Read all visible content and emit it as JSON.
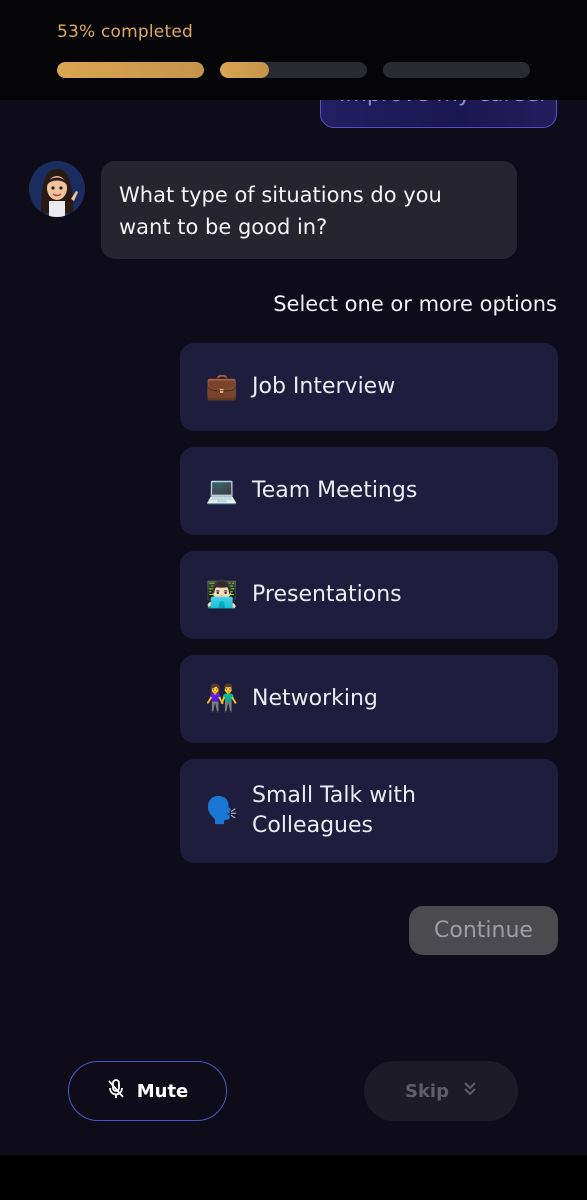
{
  "header": {
    "progress_text": "53% completed",
    "progress_percent": 53,
    "segments": [
      {
        "fill": 1.0
      },
      {
        "fill": 0.33
      },
      {
        "fill": 0.0
      }
    ]
  },
  "chat": {
    "previous_user_message": "Improve my career",
    "bot_message": "What type of situations do you want to be good in?",
    "select_hint": "Select one or more options"
  },
  "options": [
    {
      "emoji": "💼",
      "label": "Job Interview"
    },
    {
      "emoji": "💻",
      "label": "Team Meetings"
    },
    {
      "emoji": "👨🏻‍💻",
      "label": "Presentations"
    },
    {
      "emoji": "👫",
      "label": "Networking"
    },
    {
      "emoji": "🗣️",
      "label": "Small Talk with Colleagues"
    }
  ],
  "buttons": {
    "continue_label": "Continue",
    "mute_label": "Mute",
    "skip_label": "Skip"
  },
  "colors": {
    "background": "#0d0c18",
    "accent_gold": "#d9a552",
    "option_bg": "#1f1d3d",
    "mute_border": "#4a56c8"
  },
  "icons": {
    "mute": "mic-off-icon",
    "skip": "chevrons-down-icon"
  }
}
